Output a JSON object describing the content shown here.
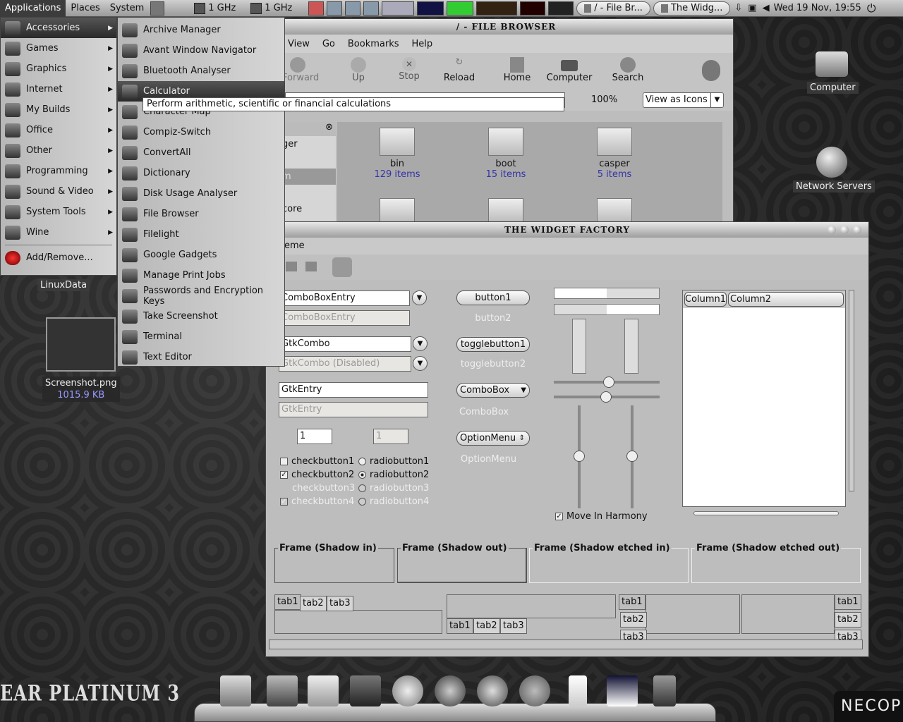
{
  "panel": {
    "menus": [
      "Applications",
      "Places",
      "System"
    ],
    "cpu1": "1 GHz",
    "cpu2": "1 GHz",
    "tasks": [
      "/ - File Br...",
      "The Widg..."
    ],
    "clock": "Wed 19 Nov, 19:55"
  },
  "apps_menu": {
    "items": [
      {
        "label": "Accessories",
        "icon": "accessories-icon"
      },
      {
        "label": "Games",
        "icon": "games-icon"
      },
      {
        "label": "Graphics",
        "icon": "graphics-icon"
      },
      {
        "label": "Internet",
        "icon": "internet-icon"
      },
      {
        "label": "My Builds",
        "icon": "builds-icon"
      },
      {
        "label": "Office",
        "icon": "office-icon"
      },
      {
        "label": "Other",
        "icon": "other-icon"
      },
      {
        "label": "Programming",
        "icon": "programming-icon"
      },
      {
        "label": "Sound & Video",
        "icon": "sound-video-icon"
      },
      {
        "label": "System Tools",
        "icon": "system-tools-icon"
      },
      {
        "label": "Wine",
        "icon": "wine-icon"
      }
    ],
    "add_remove": "Add/Remove..."
  },
  "accessories_menu": {
    "items": [
      "Archive Manager",
      "Avant Window Navigator",
      "Bluetooth Analyser",
      "Calculator",
      "Character Map",
      "Compiz-Switch",
      "ConvertAll",
      "Dictionary",
      "Disk Usage Analyser",
      "File Browser",
      "Filelight",
      "Google Gadgets",
      "Manage Print Jobs",
      "Passwords and Encryption Keys",
      "Take Screenshot",
      "Terminal",
      "Text Editor"
    ],
    "tooltip": "Perform arithmetic, scientific or financial calculations"
  },
  "file_browser": {
    "title": "/ - FILE BROWSER",
    "menubar": [
      "View",
      "Go",
      "Bookmarks",
      "Help"
    ],
    "toolbar": [
      "Forward",
      "Up",
      "Stop",
      "Reload",
      "Home",
      "Computer",
      "Search"
    ],
    "zoom": "100%",
    "view_mode": "View as Icons",
    "side_items": [
      "ger",
      "m",
      "core"
    ],
    "folders": [
      {
        "name": "bin",
        "count": "129 items"
      },
      {
        "name": "boot",
        "count": "15 items"
      },
      {
        "name": "casper",
        "count": "5 items"
      }
    ]
  },
  "desktop": {
    "computer": "Computer",
    "network": "Network Servers",
    "linuxdata": "LinuxData",
    "screenshot_name": "Screenshot.png",
    "screenshot_size": "1015.9 KB"
  },
  "widget_factory": {
    "title": "THE WIDGET FACTORY",
    "menu": "eme",
    "combo_entry": "ComboBoxEntry",
    "combo_entry_dis": "ComboBoxEntry",
    "gtkcombo": "GtkCombo",
    "gtkcombo_dis": "GtkCombo (Disabled)",
    "entry": "GtkEntry",
    "entry_dis": "GtkEntry",
    "spin1": "1",
    "spin2": "1",
    "checks": [
      "checkbutton1",
      "checkbutton2",
      "checkbutton3",
      "checkbutton4"
    ],
    "radios": [
      "radiobutton1",
      "radiobutton2",
      "radiobutton3",
      "radiobutton4"
    ],
    "button1": "button1",
    "button2": "button2",
    "toggle1": "togglebutton1",
    "toggle2": "togglebutton2",
    "combobox": "ComboBox",
    "combobox_dis": "ComboBox",
    "optionmenu": "OptionMenu",
    "optionmenu_dis": "OptionMenu",
    "move_harmony": "Move In Harmony",
    "columns": [
      "Column1",
      "Column2"
    ],
    "frames": [
      "Frame (Shadow in)",
      "Frame (Shadow out)",
      "Frame (Shadow etched in)",
      "Frame (Shadow etched out)"
    ],
    "tabs": [
      "tab1",
      "tab2",
      "tab3"
    ]
  },
  "branding": {
    "left": "EAR PLATINUM 3",
    "right": "NECOPI"
  }
}
